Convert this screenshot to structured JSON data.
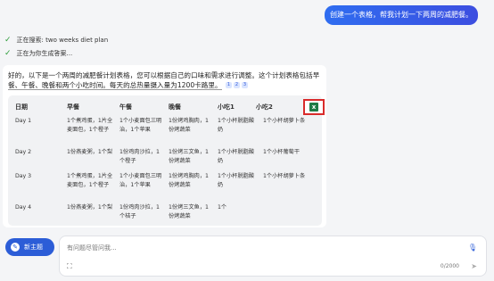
{
  "user_message": "创建一个表格，帮我计划一下两周的减肥餐。",
  "status": [
    {
      "text": "正在搜索: two weeks diet plan"
    },
    {
      "text": "正在为你生成答案..."
    }
  ],
  "answer": {
    "intro_line1": "好的，以下是一个两周的减肥餐计划表格，您可以根据自己的口味和需求进行调整。这个计划表格包括早",
    "intro_line2": "餐、午餐、晚餐和两个小吃时间。每天的总热量摄入量为1200卡路里。",
    "citations": [
      "1",
      "2",
      "3"
    ]
  },
  "table": {
    "headers": [
      "日期",
      "早餐",
      "午餐",
      "晚餐",
      "小吃1",
      "小吃2"
    ],
    "rows": [
      {
        "day": "Day 1",
        "breakfast": "1个煮鸡蛋，1片全麦面包，1个橙子",
        "lunch": "1个小麦面包三明治，1个苹果",
        "dinner": "1份烤鸡胸肉，1份烤蔬菜",
        "snack1": "1个小杯脱脂酸奶",
        "snack2": "1个小杯胡萝卜条"
      },
      {
        "day": "Day 2",
        "breakfast": "1份燕麦粥，1个梨",
        "lunch": "1份鸡肉沙拉，1个橙子",
        "dinner": "1份烤三文鱼，1份烤蔬菜",
        "snack1": "1个小杯脱脂酸奶",
        "snack2": "1个小杯葡萄干"
      },
      {
        "day": "Day 3",
        "breakfast": "1个煮鸡蛋，1片全麦面包，1个橙子",
        "lunch": "1个小麦面包三明治，1个苹果",
        "dinner": "1份烤鸡胸肉，1份烤蔬菜",
        "snack1": "1个小杯脱脂酸奶",
        "snack2": "1个小杯胡萝卜条"
      },
      {
        "day": "Day 4",
        "breakfast": "1份燕麦粥，1个梨",
        "lunch": "1份鸡肉沙拉，1个桔子",
        "dinner": "1份烤三文鱼，1份烤蔬菜",
        "snack1": "1个",
        "snack2": ""
      }
    ]
  },
  "new_topic_label": "新主题",
  "input": {
    "placeholder": "有问题尽管问我...",
    "counter": "0/2000"
  },
  "colors": {
    "accent": "#2c5dd7",
    "excel_green": "#1f7a45",
    "highlight_red": "#d92b2b"
  },
  "icons": [
    "check-icon",
    "excel-icon",
    "new-topic-icon",
    "mic-icon",
    "image-scan-icon",
    "send-icon"
  ]
}
